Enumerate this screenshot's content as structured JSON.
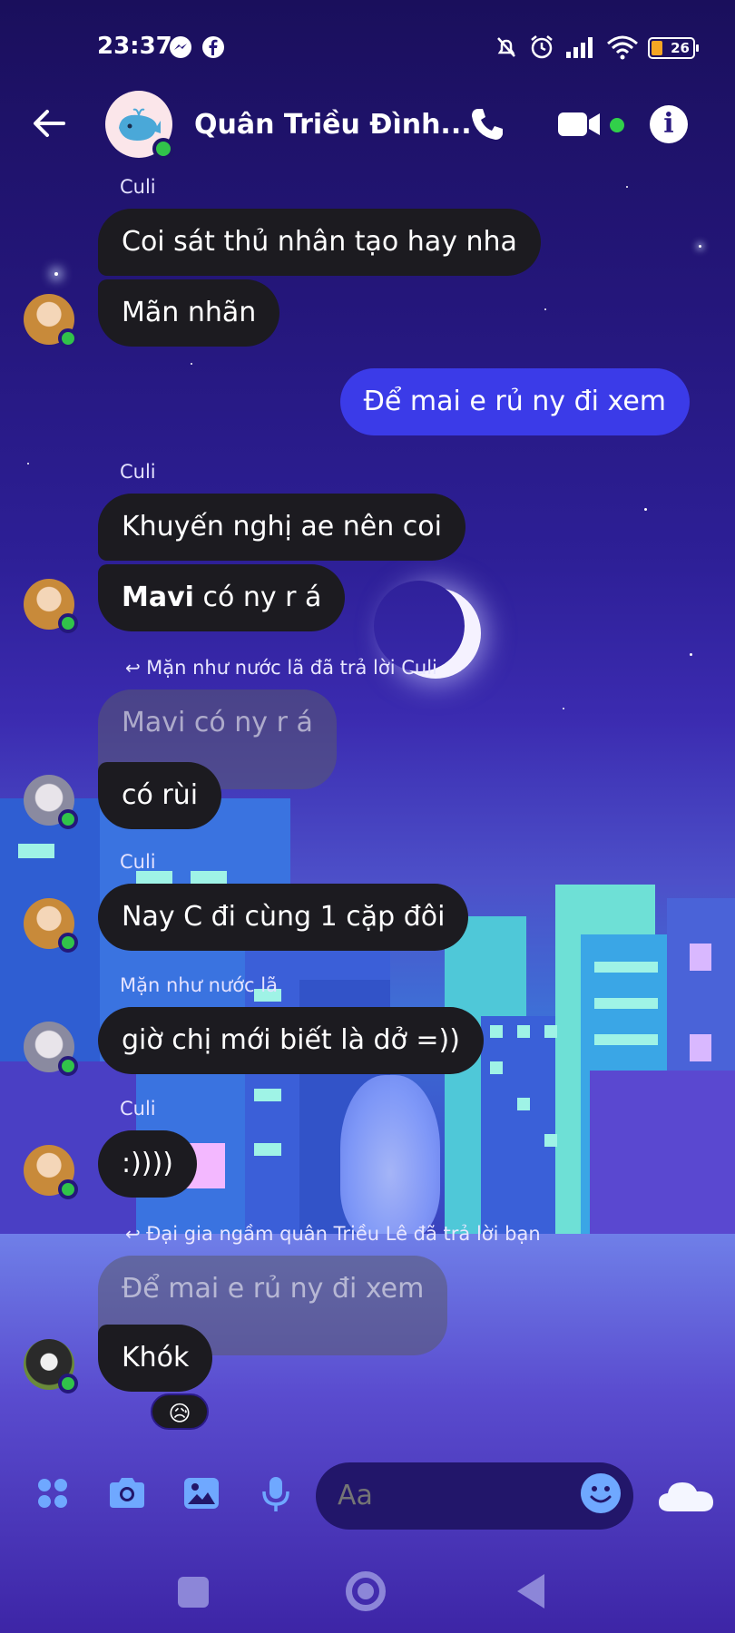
{
  "status_bar": {
    "time": "23:37",
    "battery": "26",
    "icons": [
      "messenger-icon",
      "facebook-icon",
      "mute-bell-icon",
      "alarm-icon",
      "signal-icon",
      "wifi-icon"
    ]
  },
  "header": {
    "title": "Quân Triều Đình...",
    "icons": [
      "back-arrow-icon",
      "whale-avatar-icon",
      "phone-icon",
      "video-icon",
      "info-icon"
    ],
    "info_glyph": "i"
  },
  "messages": [
    {
      "sender": "Culi",
      "text": "Coi sát thủ nhân tạo hay nha"
    },
    {
      "text": "Mãn nhãn"
    },
    {
      "text": "Để mai e rủ ny đi xem",
      "mine": true
    },
    {
      "sender": "Culi",
      "text": "Khuyến nghị ae nên coi"
    },
    {
      "bold": "Mavi",
      "text": " có ny r á"
    },
    {
      "reply_note": "Mặn như nước lã đã trả lời Culi",
      "quoted": "Mavi có ny r á",
      "text": "có rùi"
    },
    {
      "sender": "Culi",
      "text": "Nay C đi cùng 1 cặp đôi"
    },
    {
      "sender": "Mặn như nước lã",
      "text": "giờ chị mới biết là dở =))"
    },
    {
      "sender": "Culi",
      "text": ":))))"
    },
    {
      "reply_note": "Đại gia ngầm quân Triều Lê đã trả lời bạn",
      "quoted": "Để mai e rủ ny đi xem",
      "text": "Khók",
      "reaction": "😥"
    }
  ],
  "composer": {
    "placeholder": "Aa",
    "icons": [
      "apps-grid-icon",
      "camera-icon",
      "gallery-icon",
      "microphone-icon",
      "emoji-icon",
      "cloud-icon"
    ]
  },
  "colors": {
    "bubble_other": "#1c1b20",
    "bubble_mine": "#3b3be8",
    "accent_icon": "#6fa8ff",
    "online": "#31c34a"
  }
}
